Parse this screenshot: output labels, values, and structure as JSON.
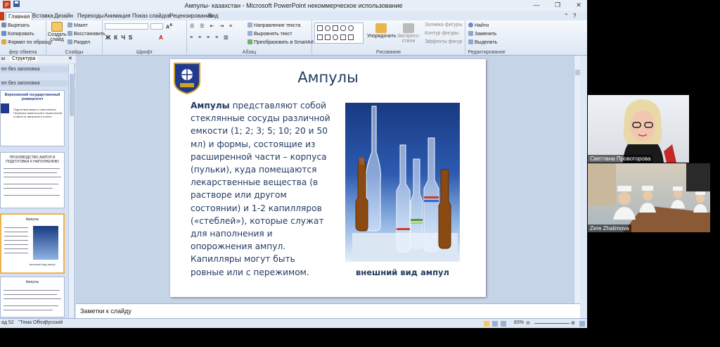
{
  "window": {
    "title": "Ампулы- казахстан - Microsoft PowerPoint некоммерческое использование"
  },
  "ribbon_tabs": [
    "Главная",
    "Вставка",
    "Дизайн",
    "Переходы",
    "Анимация",
    "Показ слайдов",
    "Рецензирование",
    "Вид"
  ],
  "clipboard": {
    "cut": "Вырезать",
    "copy": "Копировать",
    "format": "Формат по образцу",
    "label": "фер обмена"
  },
  "slides_group": {
    "create": "Создать",
    "create2": "слайд",
    "layout": "Макет",
    "reset": "Восстановить",
    "section": "Раздел",
    "label": "Слайды"
  },
  "font_group": {
    "label": "Шрифт"
  },
  "paragraph_group": {
    "dir": "Направление текста",
    "align": "Выровнять текст",
    "smartart": "Преобразовать в SmartArt",
    "label": "Абзац"
  },
  "drawing_group": {
    "arrange": "Упорядочить",
    "styles": "Экспресс-стили",
    "fill": "Заливка фигуры",
    "outline": "Контур фигуры",
    "effects": "Эффекты фигур",
    "label": "Рисование"
  },
  "editing_group": {
    "find": "Найти",
    "replace": "Заменить",
    "select": "Выделить",
    "label": "Редактирование"
  },
  "left_panel": {
    "tabs": [
      "ы",
      "Структура"
    ],
    "section1": "ел без заголовка",
    "section2": "ел без заголовка",
    "thumb1_title": "Воронежский государственный университет",
    "thumb1_sub": "Подготовка ампул к наполнению. Проверка химической и термической стойкости ампульного стекла",
    "thumb2_title": "ПРОИЗВОДСТВО АМПУЛ И ПОДГОТОВКА К НАПОЛНЕНИЮ",
    "thumb3_title": "Ампулы",
    "thumb3_caption": "внешний вид ампул",
    "thumb4_title": "Ампулы"
  },
  "slide": {
    "title": "Ампулы",
    "body_bold": "Ампулы",
    "body_rest": " представляют собой стеклянные сосуды различной емкости (1; 2; 3; 5; 10; 20 и 50 мл) и формы, состоящие из расширенной части – корпуса (пульки), куда помещаются лекарственные вещества (в растворе или другом состоянии) и 1-2 капилляров («стеблей»), которые служат для наполнения и опорожнения ампул. Капилляры могут быть ровные или с пережимом.",
    "caption": "внешний вид ампул"
  },
  "notes": {
    "placeholder": "Заметки к слайду"
  },
  "status": {
    "slide": "ад 52",
    "theme": "\"Тема Office\"",
    "lang": "русский",
    "zoom": "83%"
  },
  "video": {
    "person1": "Светлана Провоторова",
    "person2": "Zere Zhalimova"
  }
}
